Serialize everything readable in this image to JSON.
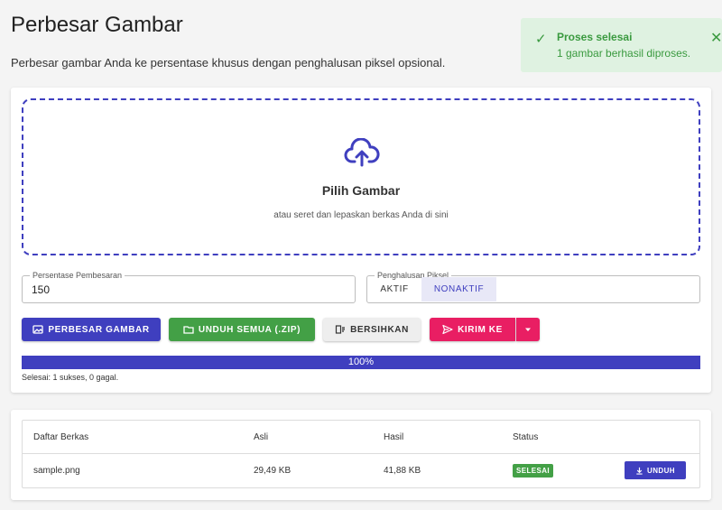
{
  "header": {
    "title": "Perbesar Gambar",
    "description": "Perbesar gambar Anda ke persentase khusus dengan penghalusan piksel opsional."
  },
  "toast": {
    "title": "Proses selesai",
    "message": "1 gambar berhasil diproses.",
    "icon": "check-icon",
    "close_icon": "close-icon"
  },
  "dropzone": {
    "title": "Pilih Gambar",
    "subtitle": "atau seret dan lepaskan berkas Anda di sini",
    "icon": "cloud-upload-icon"
  },
  "form": {
    "percentage_label": "Persentase Pembesaran",
    "percentage_value": "150",
    "smoothing_label": "Penghalusan Piksel",
    "smoothing_on": "AKTIF",
    "smoothing_off": "NONAKTIF",
    "smoothing_selected": "NONAKTIF"
  },
  "actions": {
    "enlarge": "PERBESAR GAMBAR",
    "download_zip": "UNDUH SEMUA (.ZIP)",
    "clear": "BERSIHKAN",
    "send_to": "KIRIM KE"
  },
  "progress": {
    "value": 100,
    "label": "100%",
    "summary": "Selesai: 1 sukses, 0 gagal."
  },
  "table": {
    "headers": [
      "Daftar Berkas",
      "Asli",
      "Hasil",
      "Status"
    ],
    "rows": [
      {
        "name": "sample.png",
        "original": "29,49 KB",
        "result": "41,88 KB",
        "status": "SELESAI",
        "action": "UNDUH"
      }
    ]
  },
  "colors": {
    "primary": "#3f3fbf",
    "success": "#43a046",
    "accent": "#e91e63",
    "toast_bg": "#dff2e1"
  }
}
